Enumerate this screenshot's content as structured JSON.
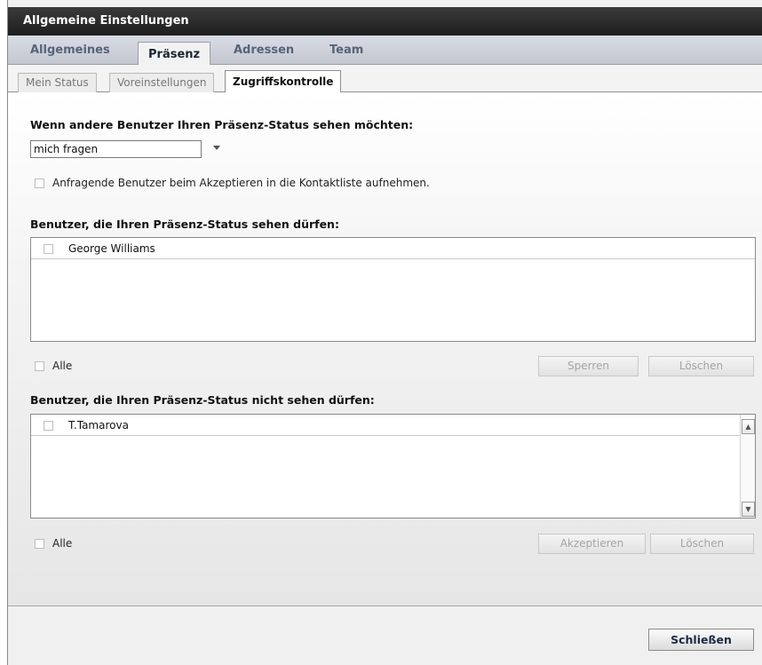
{
  "window": {
    "title": "Allgemeine Einstellungen"
  },
  "main_tabs": [
    {
      "label": "Allgemeines",
      "active": false
    },
    {
      "label": "Präsenz",
      "active": true
    },
    {
      "label": "Adressen",
      "active": false
    },
    {
      "label": "Team",
      "active": false
    }
  ],
  "sub_tabs": [
    {
      "label": "Mein Status",
      "active": false
    },
    {
      "label": "Voreinstellungen",
      "active": false
    },
    {
      "label": "Zugriffskontrolle",
      "active": true
    }
  ],
  "access": {
    "request_heading": "Wenn andere Benutzer Ihren Präsenz-Status sehen möchten:",
    "request_select_value": "mich fragen",
    "auto_add_checkbox_label": "Anfragende Benutzer beim Akzeptieren in die Kontaktliste aufnehmen.",
    "auto_add_checked": false
  },
  "allowed": {
    "heading": "Benutzer, die Ihren Präsenz-Status sehen dürfen:",
    "users": [
      {
        "name": "George Williams",
        "checked": false
      }
    ],
    "all_label": "Alle",
    "block_button": "Sperren",
    "delete_button": "Löschen"
  },
  "blocked": {
    "heading": "Benutzer, die Ihren Präsenz-Status nicht sehen dürfen:",
    "users": [
      {
        "name": "T.Tamarova",
        "checked": false
      }
    ],
    "all_label": "Alle",
    "accept_button": "Akzeptieren",
    "delete_button": "Löschen"
  },
  "footer": {
    "close_button": "Schließen"
  }
}
